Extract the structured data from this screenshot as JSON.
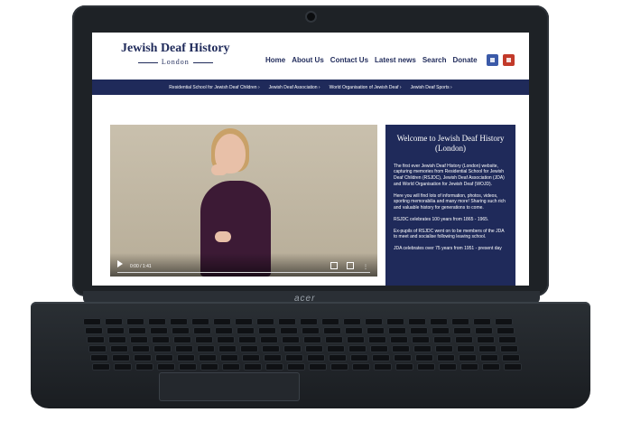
{
  "site": {
    "logo_title": "Jewish Deaf History",
    "logo_subtitle": "London",
    "nav": [
      "Home",
      "About Us",
      "Contact Us",
      "Latest news",
      "Search",
      "Donate"
    ],
    "subnav": [
      "Residential School for Jewish Deaf Children ›",
      "Jewish Deaf Association ›",
      "World Organisation of Jewish Deaf ›",
      "Jewish Deaf Sports ›"
    ],
    "video": {
      "time": "0:00 / 1:41"
    },
    "welcome": {
      "title": "Welcome to Jewish Deaf History (London)",
      "paragraphs": [
        "The first ever Jewish Deaf History (London) website, capturing memories from Residential School for Jewish Deaf Children (RSJDC), Jewish Deaf Association (JDA) and World Organisation for Jewish Deaf (WOJD).",
        "Here you will find lots of information, photos, videos, sporting memorabilia and many more! Sharing such rich and valuable history for generations to come.",
        "RSJDC celebrates 100 years from 1865 - 1965.",
        "Ex-pupils of RSJDC went on to be members of the JDA to meet and socialise following leaving school.",
        "JDA celebrates over 75 years from 1951 - present day"
      ]
    }
  },
  "laptop": {
    "brand": "acer"
  },
  "colors": {
    "navy": "#1f2a5a",
    "facebook": "#3b5aa8",
    "youtube": "#c23a2a"
  },
  "icons": [
    "facebook-icon",
    "youtube-icon",
    "play-icon",
    "volume-icon",
    "fullscreen-icon",
    "more-options-icon"
  ]
}
